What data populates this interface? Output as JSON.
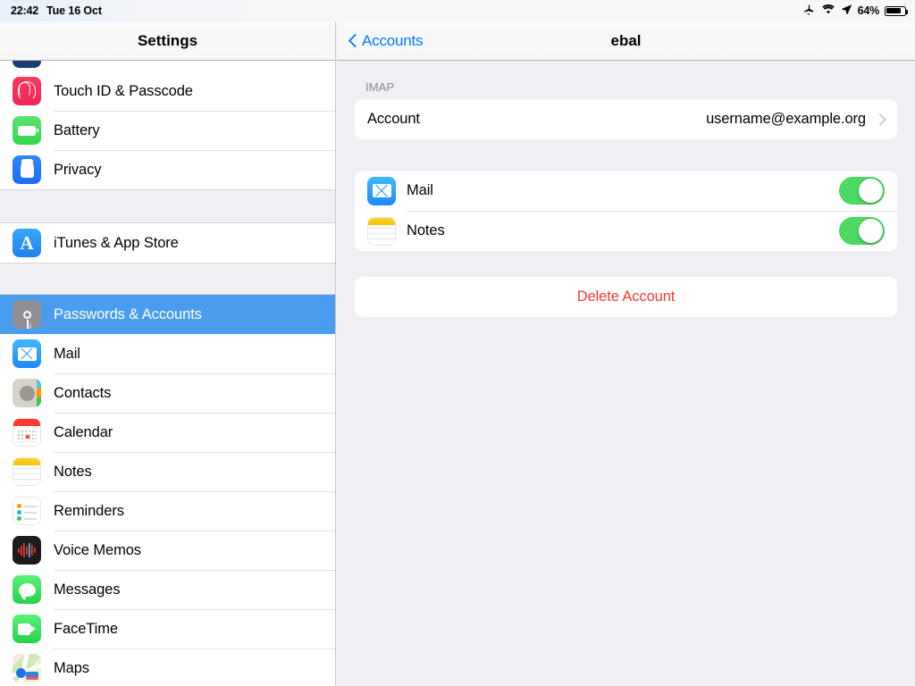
{
  "status_bar": {
    "time": "22:42",
    "date": "Tue 16 Oct",
    "airplane_icon": "airplane-icon",
    "wifi_icon": "wifi-icon",
    "location_icon": "location-arrow-icon",
    "battery_percent": "64%",
    "battery_icon": "battery-icon"
  },
  "sidebar": {
    "title": "Settings",
    "selected_index": 5,
    "items": [
      {
        "label": "Touch ID & Passcode",
        "icon": "touchid-icon",
        "icon_class": "ic-touchid"
      },
      {
        "label": "Battery",
        "icon": "battery-icon",
        "icon_class": "ic-battery"
      },
      {
        "label": "Privacy",
        "icon": "privacy-hand-icon",
        "icon_class": "ic-privacy"
      },
      {
        "label": "iTunes & App Store",
        "icon": "app-store-icon",
        "icon_class": "ic-appstore"
      },
      {
        "label": "Passwords & Accounts",
        "icon": "key-icon",
        "icon_class": "ic-key"
      },
      {
        "label": "Mail",
        "icon": "mail-icon",
        "icon_class": "ic-mail"
      },
      {
        "label": "Contacts",
        "icon": "contacts-icon",
        "icon_class": "ic-contacts"
      },
      {
        "label": "Calendar",
        "icon": "calendar-icon",
        "icon_class": "ic-calendar"
      },
      {
        "label": "Notes",
        "icon": "notes-icon",
        "icon_class": "ic-notes"
      },
      {
        "label": "Reminders",
        "icon": "reminders-icon",
        "icon_class": "ic-reminders"
      },
      {
        "label": "Voice Memos",
        "icon": "voice-memos-icon",
        "icon_class": "ic-voicememos"
      },
      {
        "label": "Messages",
        "icon": "messages-icon",
        "icon_class": "ic-messages"
      },
      {
        "label": "FaceTime",
        "icon": "facetime-icon",
        "icon_class": "ic-facetime"
      },
      {
        "label": "Maps",
        "icon": "maps-icon",
        "icon_class": "ic-maps"
      }
    ]
  },
  "detail": {
    "back_label": "Accounts",
    "back_icon": "chevron-left-icon",
    "title": "ebal",
    "section_header": "IMAP",
    "account_row": {
      "label": "Account",
      "value": "username@example.org",
      "chevron_icon": "chevron-right-icon"
    },
    "services": [
      {
        "label": "Mail",
        "icon": "mail-icon",
        "icon_class": "ic-mail",
        "enabled": true
      },
      {
        "label": "Notes",
        "icon": "notes-icon",
        "icon_class": "ic-notes",
        "enabled": true
      }
    ],
    "delete_label": "Delete Account"
  },
  "colors": {
    "accent_blue": "#007aff",
    "selection_blue": "#4a9dee",
    "toggle_green": "#4cd964",
    "destructive_red": "#ff3b30",
    "grouped_bg": "#efeff4"
  }
}
